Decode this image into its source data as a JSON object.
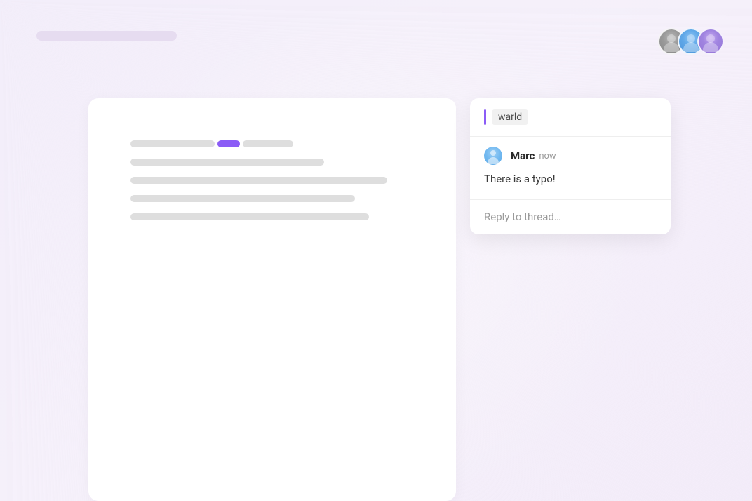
{
  "avatars": [
    {
      "colorClass": "avatar-gray"
    },
    {
      "colorClass": "avatar-blue"
    },
    {
      "colorClass": "avatar-purple"
    }
  ],
  "document": {
    "line1": {
      "seg1_width": 120,
      "seg2_width": 32,
      "seg3_width": 72
    },
    "line_widths": [
      276,
      366,
      320,
      340
    ]
  },
  "comment": {
    "quoted_text": "warld",
    "author": "Marc",
    "timestamp": "now",
    "body": "There is a typo!",
    "reply_placeholder": "Reply to thread…"
  }
}
